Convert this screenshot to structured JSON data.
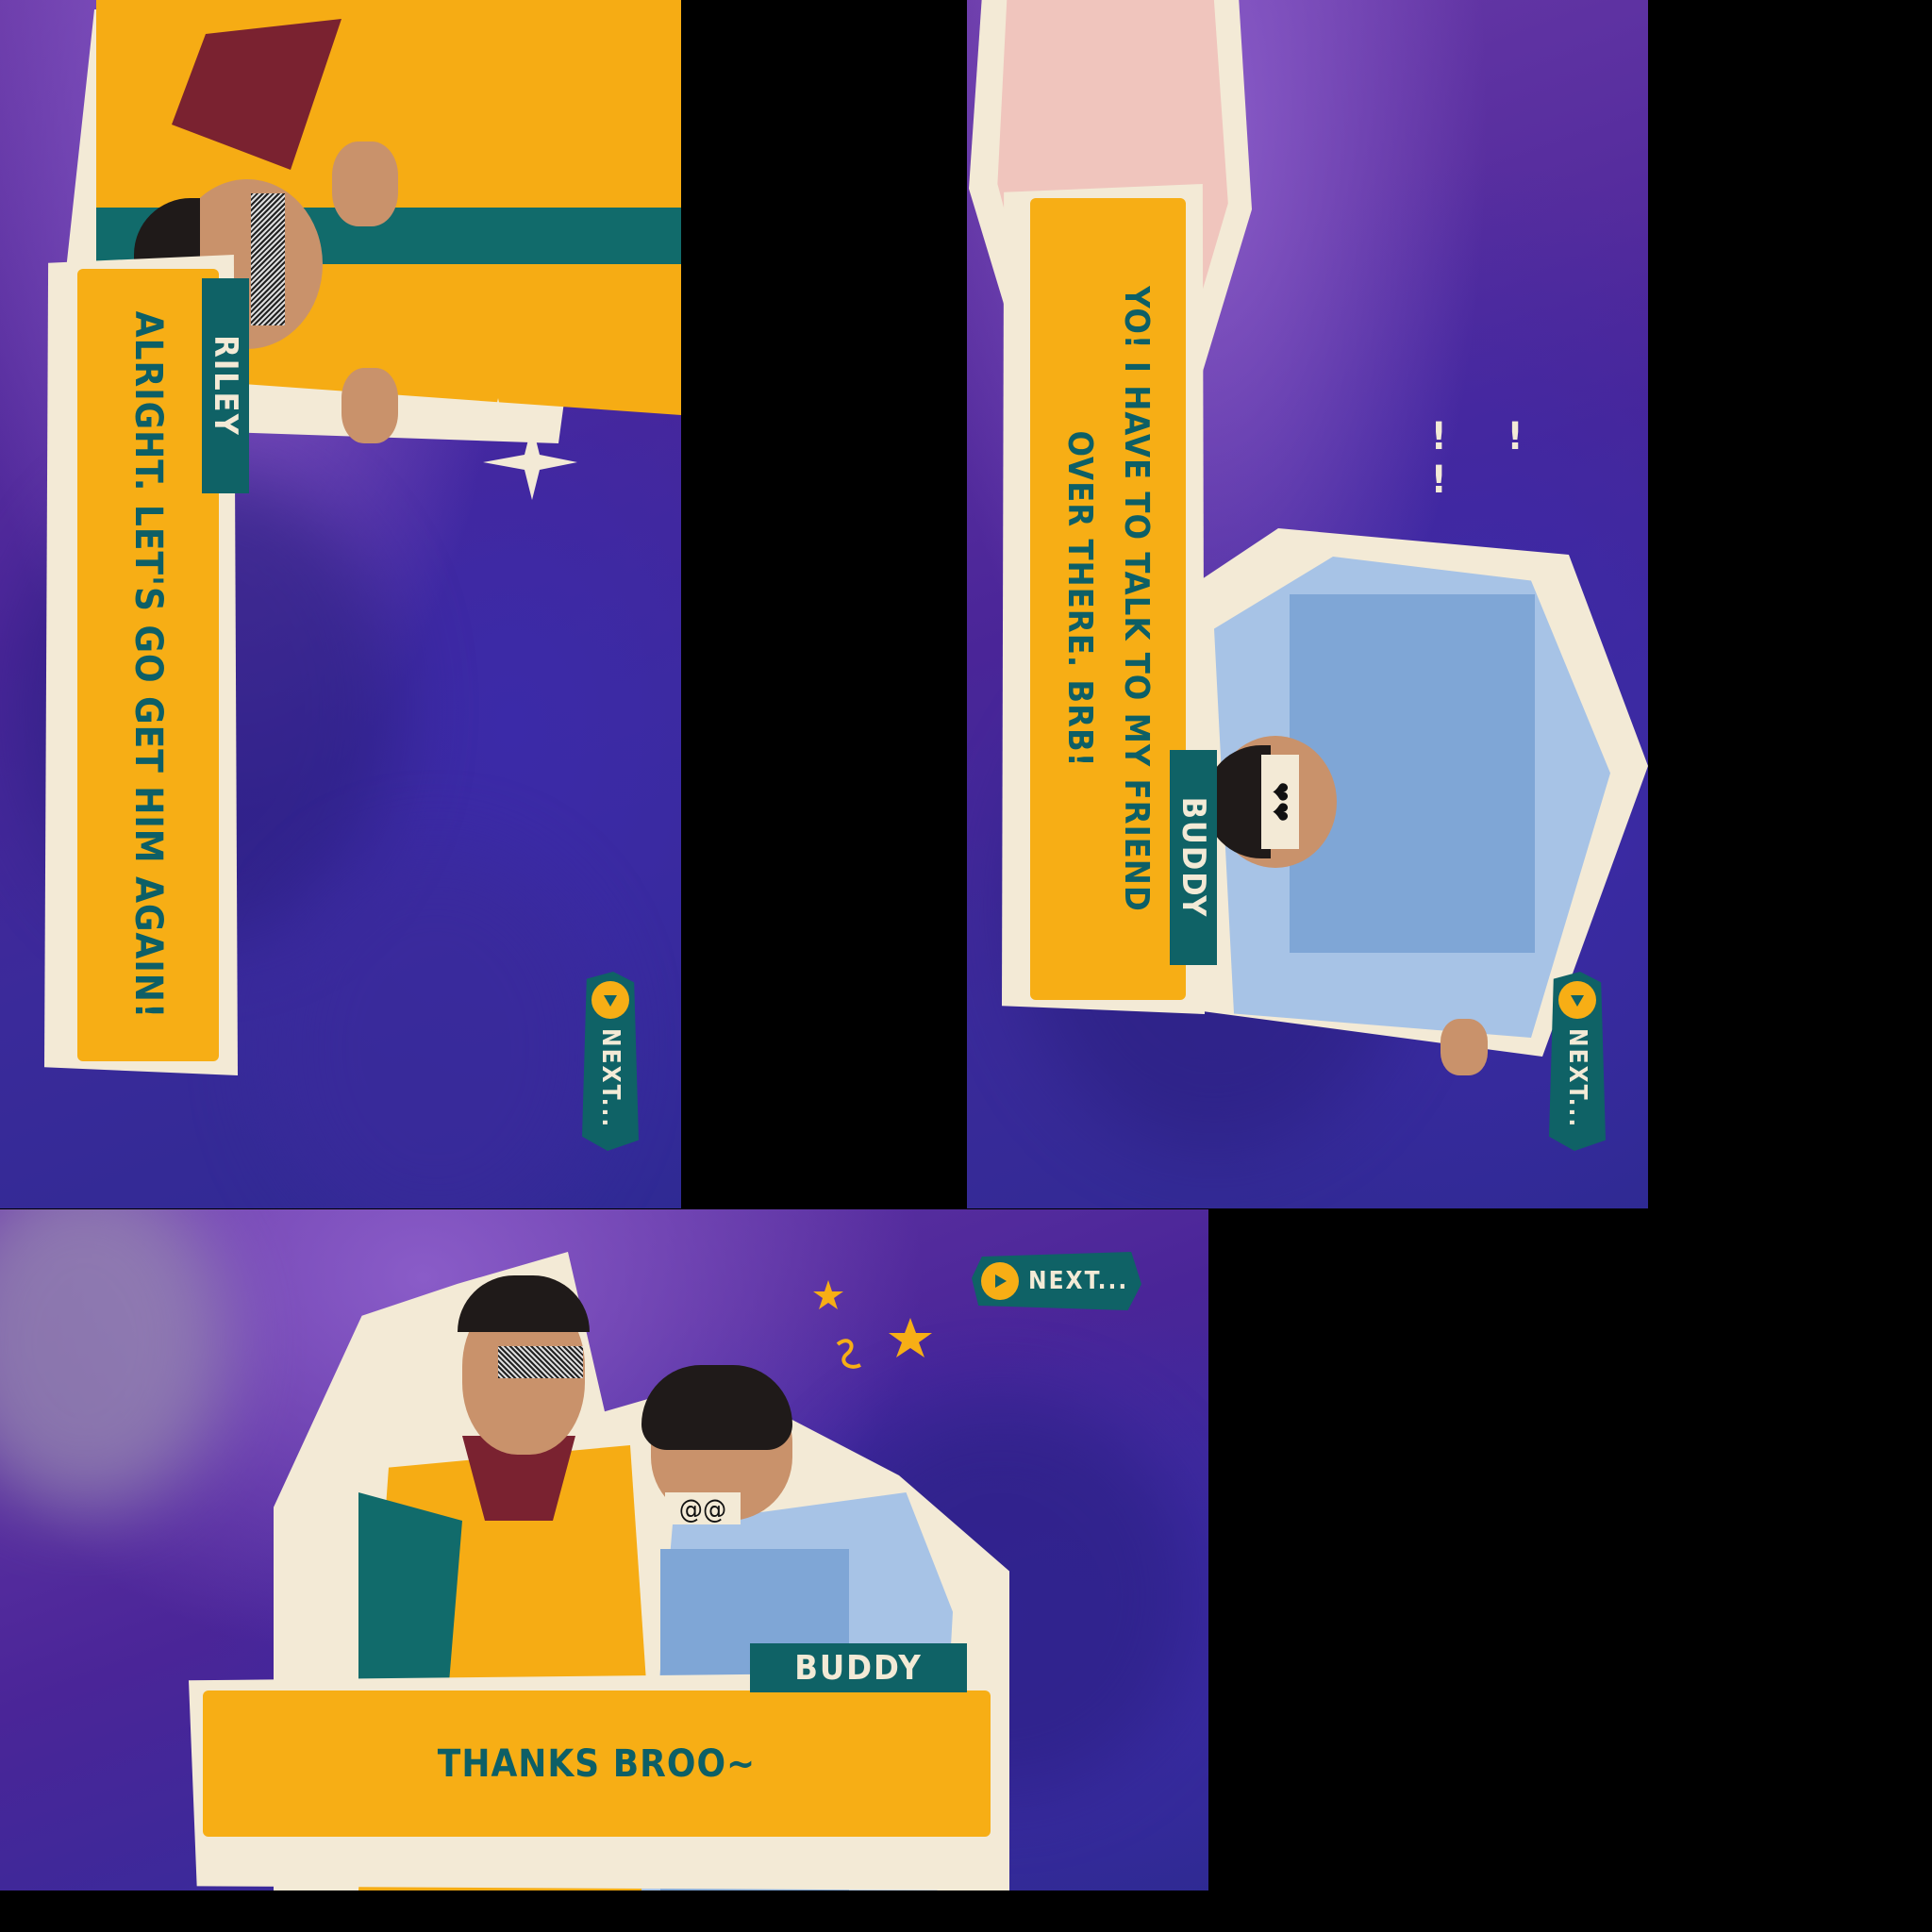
{
  "panels": [
    {
      "id": "panel-1",
      "speaker": "RILEY",
      "dialog": "ALRIGHT. LET'S GO GET HIM AGAIN!",
      "next_label": "NEXT..."
    },
    {
      "id": "panel-2",
      "speaker": "BUDDY",
      "dialog": "YO! I HAVE TO TALK TO MY FRIEND OVER THERE. BRB!",
      "exclaim": "! ! !",
      "next_label": "NEXT..."
    },
    {
      "id": "panel-3",
      "speaker": "BUDDY",
      "dialog": "THANKS BROO~",
      "next_label": "NEXT..."
    }
  ],
  "colors": {
    "dialog_fill": "#f7ae15",
    "dialog_text": "#0d5f66",
    "name_tag": "#0f6266",
    "paper": "#f3ead6",
    "background": "#4a2598"
  },
  "icons": [
    "play-icon",
    "sparkle-icon",
    "star-icon",
    "heart-eyes-icon",
    "spiral-eyes-icon"
  ]
}
